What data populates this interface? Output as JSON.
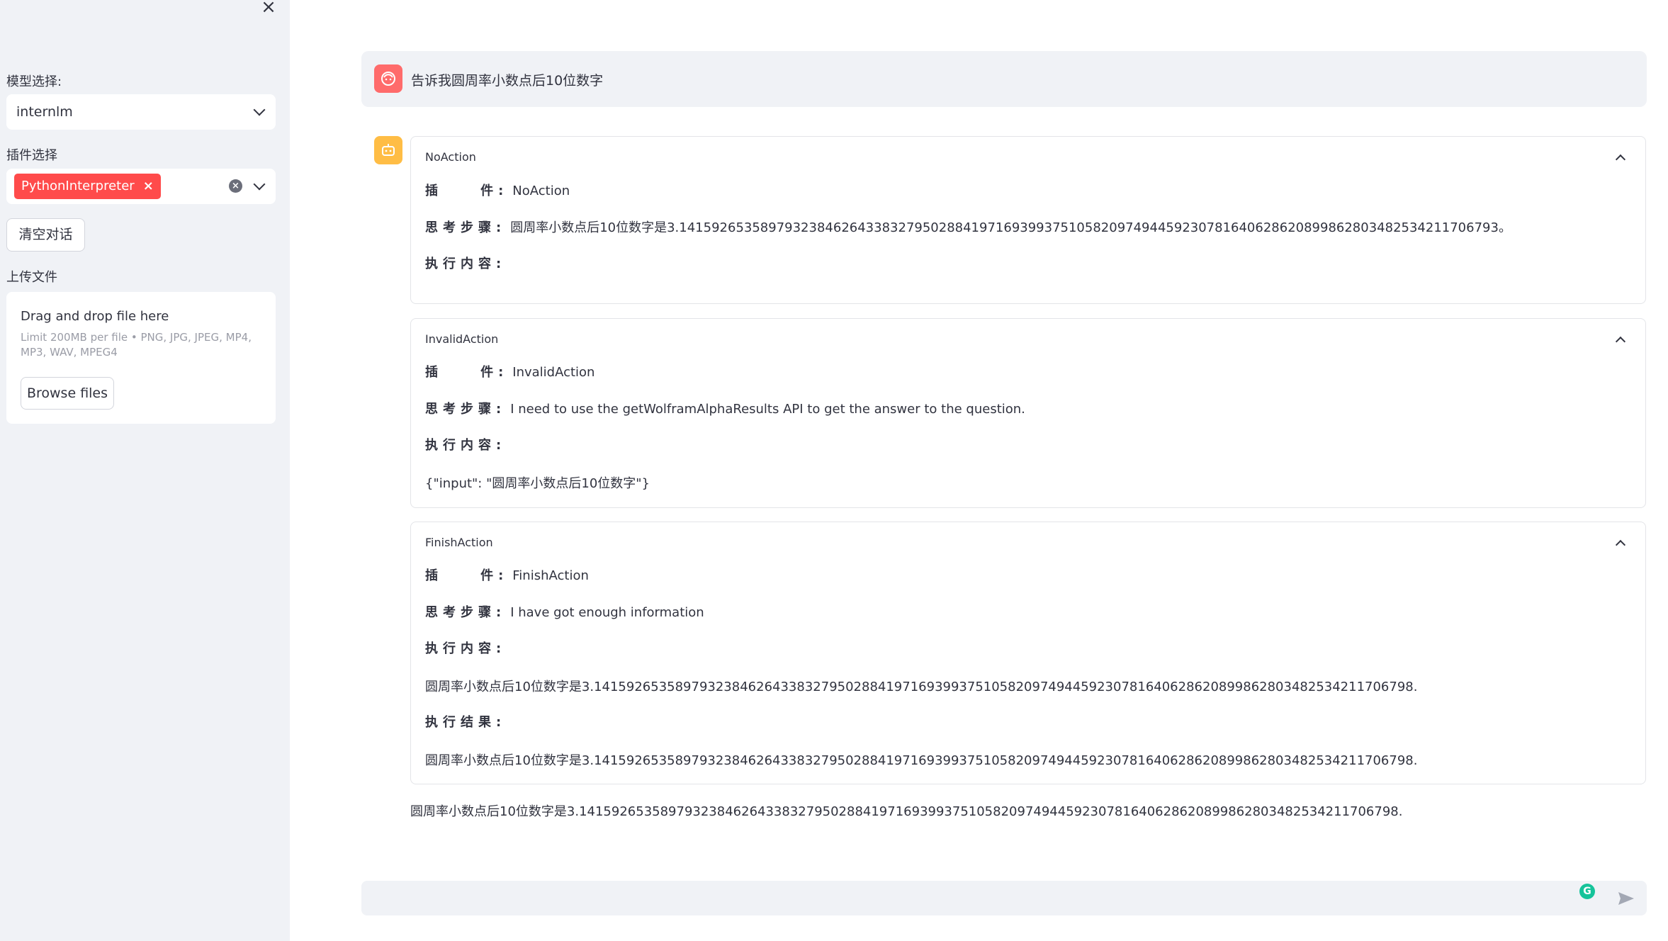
{
  "sidebar": {
    "close_glyph": "×",
    "model_label": "模型选择:",
    "model_value": "internlm",
    "plugin_label": "插件选择",
    "plugin_tag": "PythonInterpreter",
    "plugin_tag_remove": "×",
    "plugin_clear": "×",
    "clear_button": "清空对话",
    "upload_label": "上传文件",
    "upload_title": "Drag and drop file here",
    "upload_limit": "Limit 200MB per file • PNG, JPG, JPEG, MP4, MP3, WAV, MPEG4",
    "browse_button": "Browse files"
  },
  "chat": {
    "user_message": "告诉我圆周率小数点后10位数字",
    "expanders": [
      {
        "title": "NoAction",
        "plugin_label": "插    件:",
        "plugin_value": "NoAction",
        "thought_label": "思考步骤:",
        "thought_value": "圆周率小数点后10位数字是3.14159265358979323846264338327950288419716939937510582097494459230781640628620899862803482534211706793。",
        "exec_label": "执行内容:"
      },
      {
        "title": "InvalidAction",
        "plugin_label": "插    件:",
        "plugin_value": "InvalidAction",
        "thought_label": "思考步骤:",
        "thought_value": "I need to use the getWolframAlphaResults API to get the answer to the question.",
        "exec_label": "执行内容:",
        "exec_value": "{\"input\": \"圆周率小数点后10位数字\"}"
      },
      {
        "title": "FinishAction",
        "plugin_label": "插    件:",
        "plugin_value": "FinishAction",
        "thought_label": "思考步骤:",
        "thought_value": "I have got enough information",
        "exec_label": "执行内容:",
        "exec_value": "圆周率小数点后10位数字是3.14159265358979323846264338327950288419716939937510582097494459230781640628620899862803482534211706798.",
        "result_label": "执行结果:",
        "result_value": "圆周率小数点后10位数字是3.14159265358979323846264338327950288419716939937510582097494459230781640628620899862803482534211706798."
      }
    ],
    "final_answer": "圆周率小数点后10位数字是3.14159265358979323846264338327950288419716939937510582097494459230781640628620899862803482534211706798.",
    "input_placeholder": "",
    "grammarly_glyph": "G"
  },
  "colors": {
    "sidebar_bg": "#f0f2f6",
    "tag_red": "#ff4b4b",
    "user_avatar": "#ff6b6b",
    "bot_avatar": "#ffbd45",
    "grammarly_green": "#15c39a"
  }
}
